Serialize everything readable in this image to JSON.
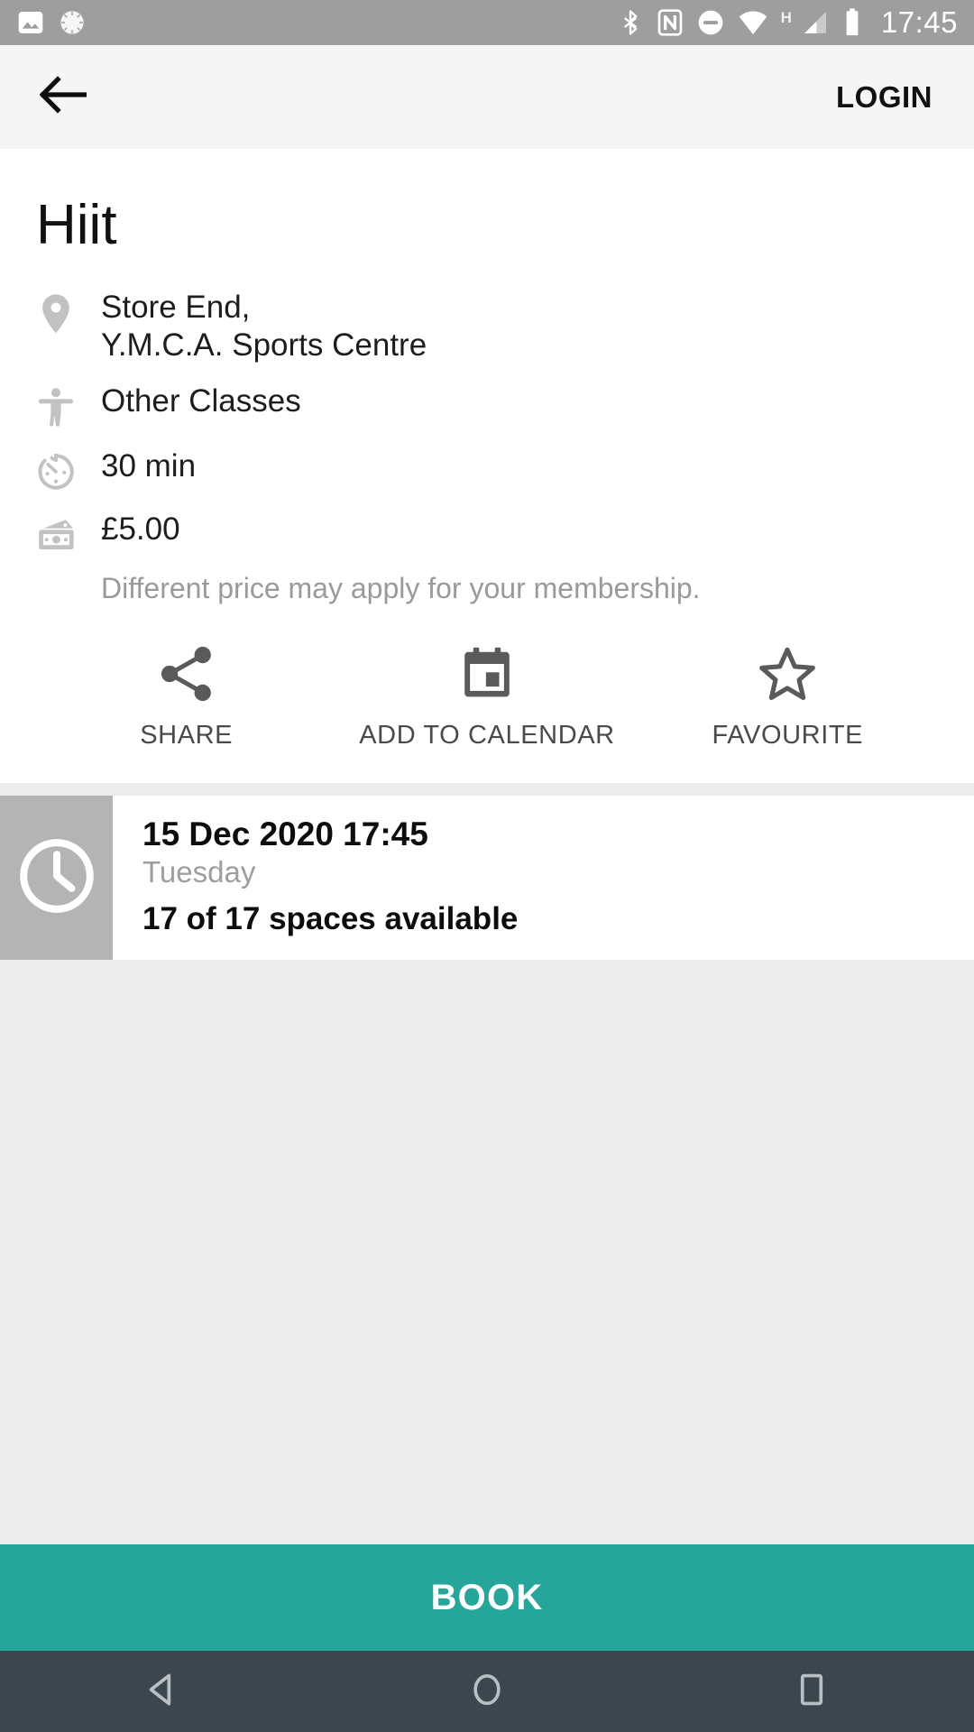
{
  "status_bar": {
    "time": "17:45",
    "network_type": "H",
    "left_icons": [
      "image-icon",
      "sync-spinner-icon"
    ],
    "right_icons": [
      "bluetooth-icon",
      "nfc-icon",
      "do-not-disturb-icon",
      "wifi-icon",
      "signal-icon",
      "battery-icon"
    ],
    "background": "#9e9e9e"
  },
  "app_bar": {
    "back_icon": "back-arrow-icon",
    "login_label": "LOGIN",
    "background": "#f5f5f5"
  },
  "class_details": {
    "title": "Hiit",
    "location": {
      "icon": "location-pin-icon",
      "line1": "Store End,",
      "line2": "Y.M.C.A. Sports Centre"
    },
    "category": {
      "icon": "accessibility-icon",
      "label": "Other Classes"
    },
    "duration": {
      "icon": "timer-icon",
      "label": "30 min"
    },
    "price": {
      "icon": "money-icon",
      "label": "£5.00",
      "note": "Different price may apply for your membership."
    }
  },
  "actions": [
    {
      "icon": "share-icon",
      "label": "SHARE"
    },
    {
      "icon": "calendar-icon",
      "label": "ADD TO CALENDAR"
    },
    {
      "icon": "star-outline-icon",
      "label": "FAVOURITE"
    }
  ],
  "session": {
    "thumb_icon": "clock-icon",
    "date": "15 Dec 2020 17:45",
    "day": "Tuesday",
    "spaces": "17 of 17 spaces available"
  },
  "footer": {
    "book_label": "BOOK",
    "accent_color": "#26a69a"
  },
  "nav_bar": {
    "background": "#3c464e",
    "buttons": [
      "nav-back-icon",
      "nav-home-icon",
      "nav-recents-icon"
    ]
  }
}
